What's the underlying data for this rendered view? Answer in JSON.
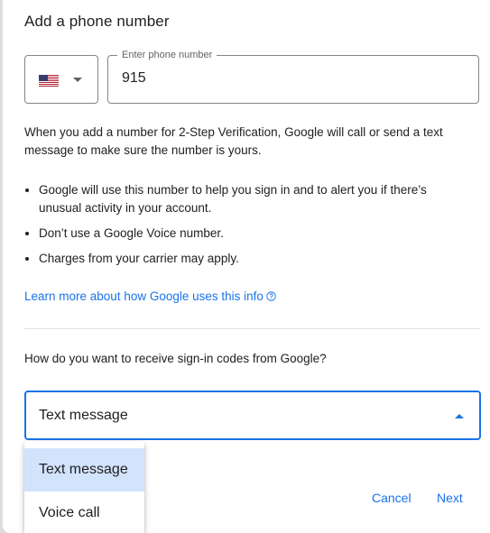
{
  "dialog": {
    "title": "Add a phone number"
  },
  "phone": {
    "country_flag": "us-flag-icon",
    "label": "Enter phone number",
    "value": "915"
  },
  "intro_text": "When you add a number for 2-Step Verification, Google will call or send a text message to make sure the number is yours.",
  "bullets": [
    "Google will use this number to help you sign in and to alert you if there’s unusual activity in your account.",
    "Don’t use a Google Voice number.",
    "Charges from your carrier may apply."
  ],
  "learn_more": {
    "label": "Learn more about how Google uses this info",
    "icon": "help-circle-icon"
  },
  "method": {
    "question": "How do you want to receive sign-in codes from Google?",
    "selected": "Text message",
    "options": [
      "Text message",
      "Voice call"
    ]
  },
  "actions": {
    "cancel_label": "Cancel",
    "next_label": "Next"
  },
  "colors": {
    "accent": "#1a73e8",
    "selected_option_bg": "#d2e3fc"
  }
}
